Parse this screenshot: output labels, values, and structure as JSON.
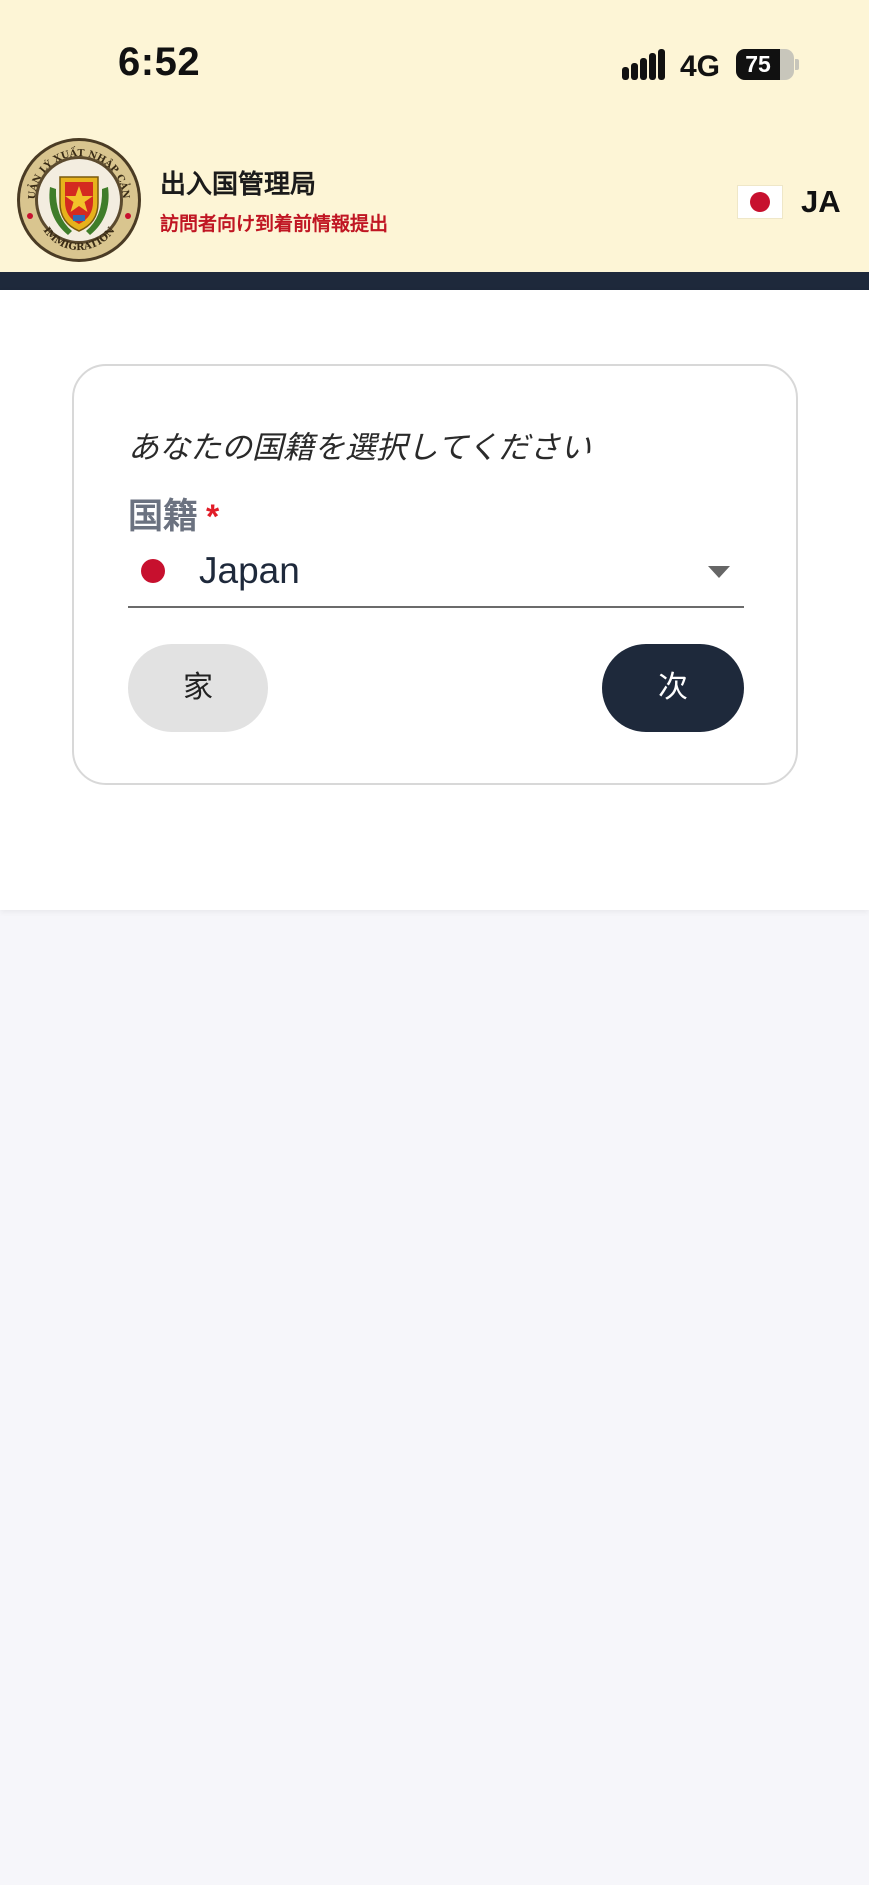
{
  "status_bar": {
    "time": "6:52",
    "network": "4G",
    "battery": "75",
    "battery_level_percent": 75
  },
  "header": {
    "title": "出入国管理局",
    "subtitle": "訪問者向け到着前情報提出",
    "logo_ring_top": "QUẢN LÝ XUẤT NHẬP CẢNH",
    "logo_ring_bottom": "IMMIGRATION",
    "language": {
      "code": "JA",
      "flag": "japan-flag-icon"
    }
  },
  "form": {
    "prompt": "あなたの国籍を選択してください",
    "nationality_label": "国籍",
    "required_mark": "*",
    "nationality": {
      "selected": "Japan",
      "flag": "japan-flag-dot-icon"
    },
    "home_button": "家",
    "next_button": "次"
  },
  "colors": {
    "header_bg": "#fdf5d6",
    "navbar": "#1e293b",
    "primary_button": "#1e293b",
    "secondary_button": "#e2e2e2",
    "subtitle_red": "#c01623",
    "required_red": "#e11d28",
    "page_bg": "#f6f6fa"
  }
}
